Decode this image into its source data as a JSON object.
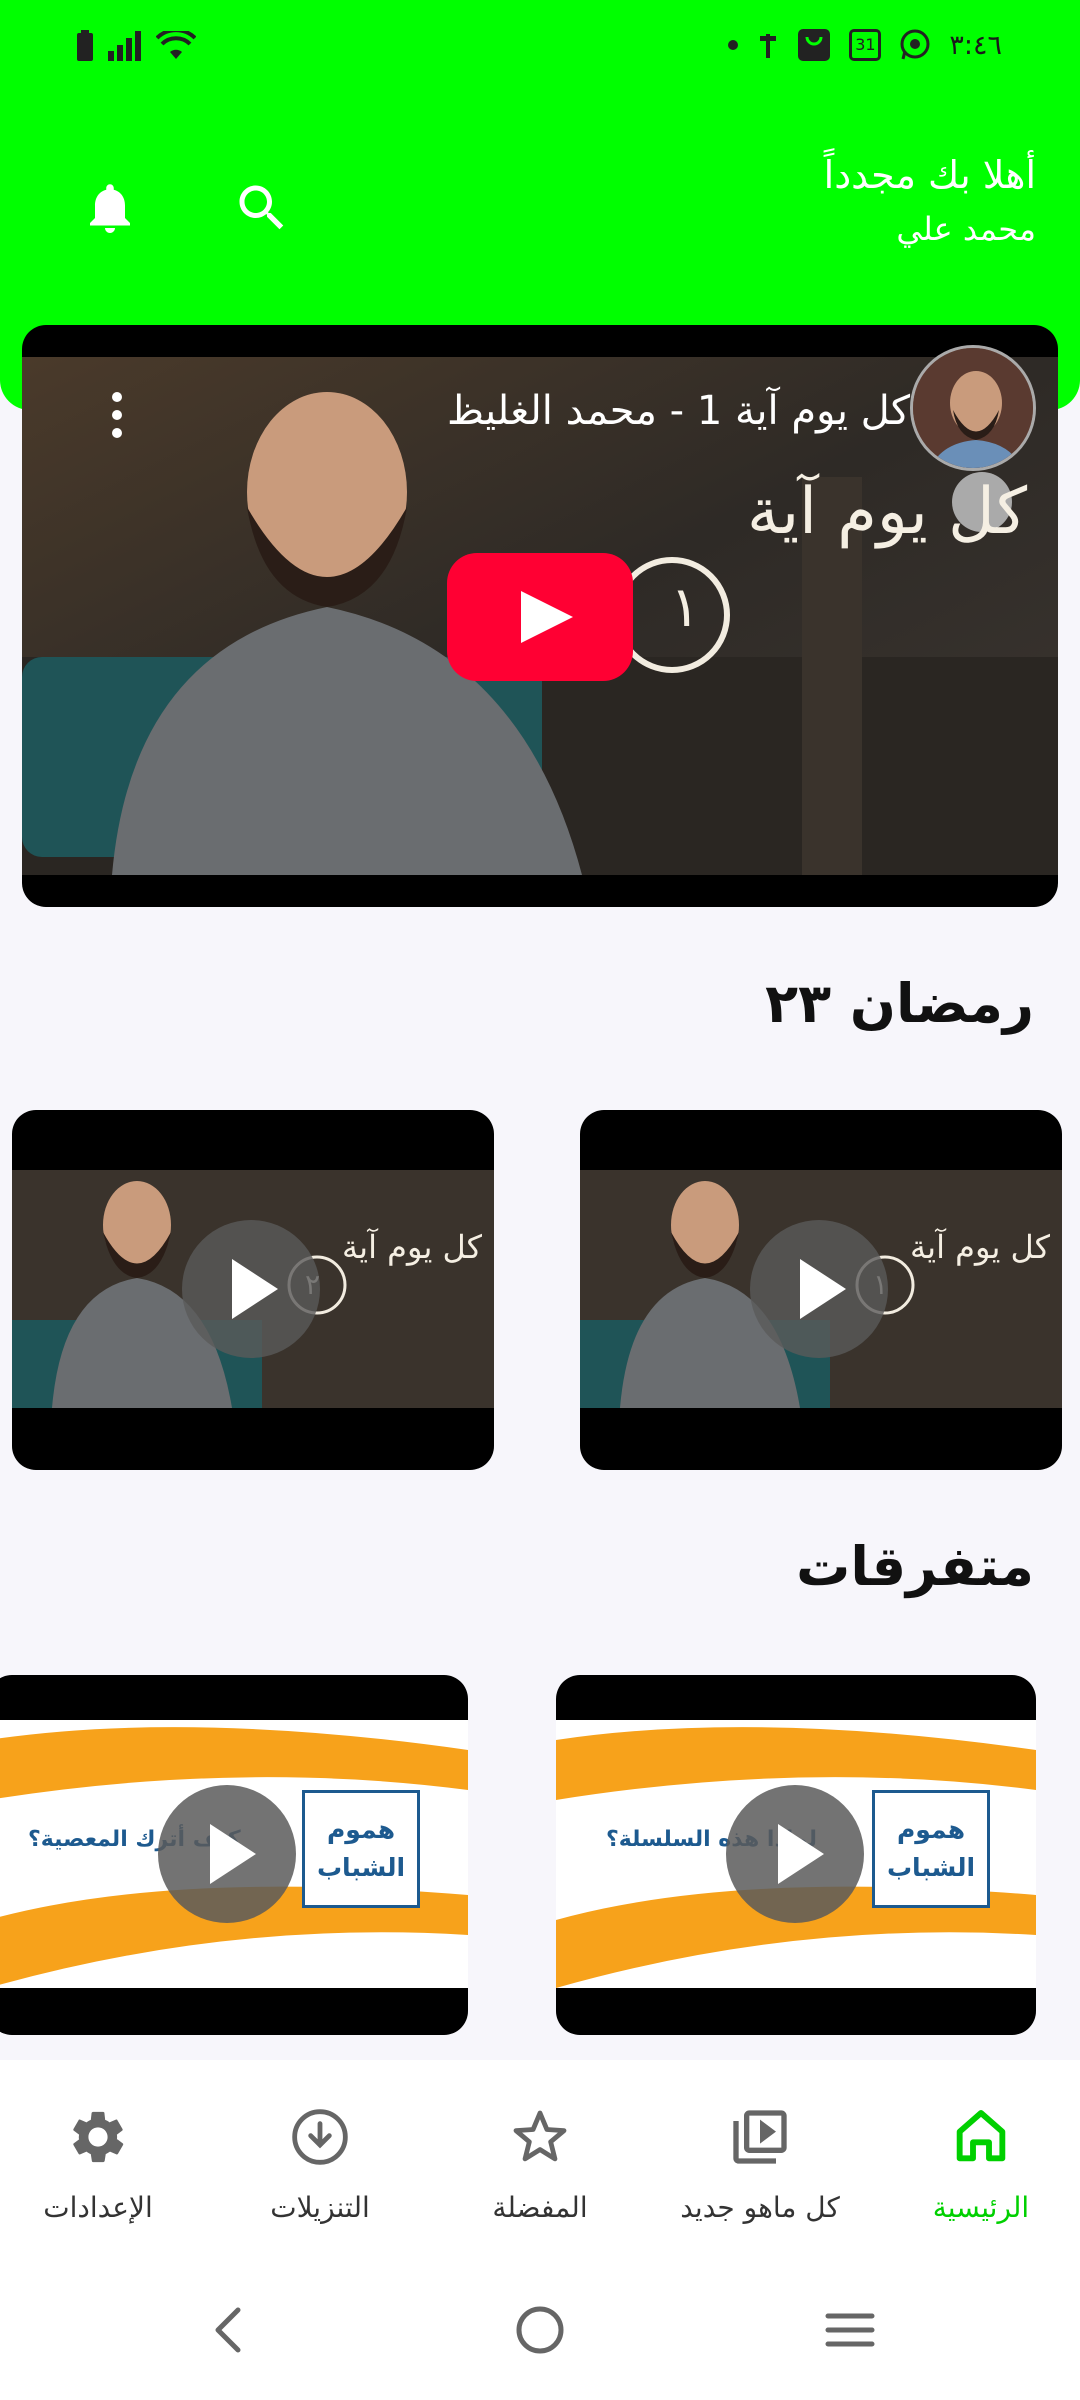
{
  "status_bar": {
    "time": "٣:٤٦",
    "calendar_day": "31",
    "icons": [
      "battery-icon",
      "signal-icon",
      "wifi-icon",
      "dot-icon",
      "usb-icon",
      "shopping-bag-icon",
      "calendar-icon",
      "whatsapp-icon"
    ]
  },
  "header": {
    "greeting": "أهلا بك مجدداً",
    "user_name": "محمد علي",
    "accent_color": "#00ff00"
  },
  "hero_video": {
    "title": "كل يوم آية 1 - محمد الغليظ",
    "overlay_text": "كل يوم آية",
    "episode_numeral": "١"
  },
  "sections": [
    {
      "title": "رمضان ٢٣",
      "cards": [
        {
          "overlay_text": "كل يوم آية",
          "episode_numeral": "١"
        },
        {
          "overlay_text": "كل يوم آية",
          "episode_numeral": "٢"
        }
      ]
    },
    {
      "title": "متفرقات",
      "cards": [
        {
          "box_text": "هموم الشباب",
          "caption": "لماذا هذه السلسلة؟"
        },
        {
          "box_text": "هموم الشباب",
          "caption": "كيف أترك المعصية؟"
        }
      ]
    }
  ],
  "bottom_nav": {
    "items": [
      {
        "label": "الرئيسية",
        "icon": "home-icon",
        "active": true
      },
      {
        "label": "كل ماهو جديد",
        "icon": "video-library-icon",
        "active": false
      },
      {
        "label": "المفضلة",
        "icon": "star-icon",
        "active": false
      },
      {
        "label": "التنزيلات",
        "icon": "download-icon",
        "active": false
      },
      {
        "label": "الإعدادات",
        "icon": "gear-icon",
        "active": false
      }
    ]
  }
}
